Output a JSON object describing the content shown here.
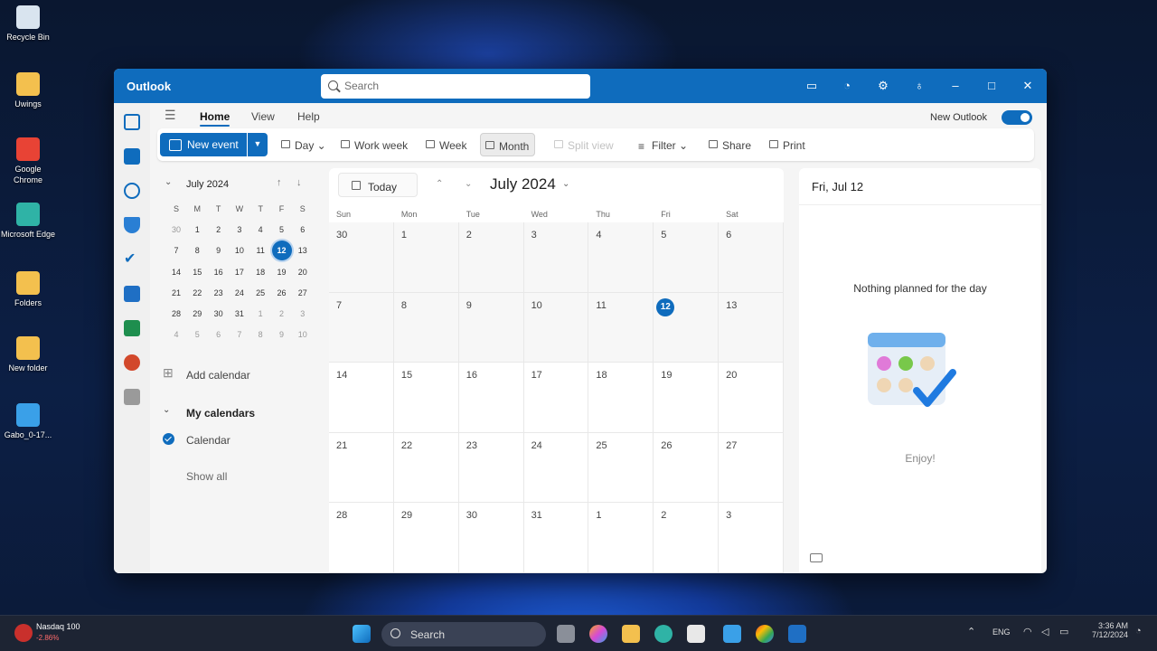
{
  "desktop": {
    "icons": [
      {
        "label": "Recycle Bin",
        "icon": "recycle-bin-icon",
        "color": "#d9e4ef"
      },
      {
        "label": "Uwings",
        "icon": "folder-icon",
        "color": "#f3c04e"
      },
      {
        "label": "Google Chrome",
        "icon": "chrome-icon",
        "color": "#e84335"
      },
      {
        "label": "Microsoft Edge",
        "icon": "edge-icon",
        "color": "#2fb3a6"
      },
      {
        "label": "Folders",
        "icon": "folder-icon",
        "color": "#f3c04e"
      },
      {
        "label": "New folder",
        "icon": "folder-icon",
        "color": "#f3c04e"
      },
      {
        "label": "Gabo_0-17...",
        "icon": "document-icon",
        "color": "#3aa0e8"
      }
    ]
  },
  "window": {
    "app_name": "Outlook",
    "search_placeholder": "Search",
    "title_icons": [
      "chat-icon",
      "bell-icon",
      "gear-icon",
      "lightbulb-icon",
      "minimize-icon",
      "maximize-icon",
      "close-icon"
    ],
    "accent": "#0f6cbd"
  },
  "tabs": {
    "home": "Home",
    "view": "View",
    "help": "Help",
    "new_outlook_label": "New Outlook",
    "new_outlook_on": true
  },
  "ribbon": {
    "new_event": "New event",
    "day": "Day",
    "work_week": "Work week",
    "week": "Week",
    "month": "Month",
    "split_view": "Split view",
    "filter": "Filter",
    "share": "Share",
    "print": "Print"
  },
  "mini_calendar": {
    "month_label": "July 2024",
    "weekday_headers": [
      "S",
      "M",
      "T",
      "W",
      "T",
      "F",
      "S"
    ],
    "weeks": [
      [
        "30",
        "1",
        "2",
        "3",
        "4",
        "5",
        "6"
      ],
      [
        "7",
        "8",
        "9",
        "10",
        "11",
        "12",
        "13"
      ],
      [
        "14",
        "15",
        "16",
        "17",
        "18",
        "19",
        "20"
      ],
      [
        "21",
        "22",
        "23",
        "24",
        "25",
        "26",
        "27"
      ],
      [
        "28",
        "29",
        "30",
        "31",
        "1",
        "2",
        "3"
      ],
      [
        "4",
        "5",
        "6",
        "7",
        "8",
        "9",
        "10"
      ]
    ],
    "selected_day": "12"
  },
  "sidebar": {
    "add_calendar": "Add calendar",
    "my_calendars": "My calendars",
    "calendar_item": "Calendar",
    "show_all": "Show all"
  },
  "month_view": {
    "today_label": "Today",
    "title": "July 2024",
    "day_headers": [
      "Sun",
      "Mon",
      "Tue",
      "Wed",
      "Thu",
      "Fri",
      "Sat"
    ],
    "weeks": [
      [
        "30",
        "1",
        "2",
        "3",
        "4",
        "5",
        "6"
      ],
      [
        "7",
        "8",
        "9",
        "10",
        "11",
        "12",
        "13"
      ],
      [
        "14",
        "15",
        "16",
        "17",
        "18",
        "19",
        "20"
      ],
      [
        "21",
        "22",
        "23",
        "24",
        "25",
        "26",
        "27"
      ],
      [
        "28",
        "29",
        "30",
        "31",
        "1",
        "2",
        "3"
      ]
    ],
    "today": "12"
  },
  "day_pane": {
    "date": "Fri, Jul 12",
    "empty_message": "Nothing planned for the day",
    "enjoy": "Enjoy!"
  },
  "taskbar": {
    "widget_title": "Nasdaq 100",
    "widget_value": "-2.86%",
    "search_placeholder": "Search",
    "lang": "ENG",
    "time": "3:36 AM",
    "date": "7/12/2024"
  }
}
